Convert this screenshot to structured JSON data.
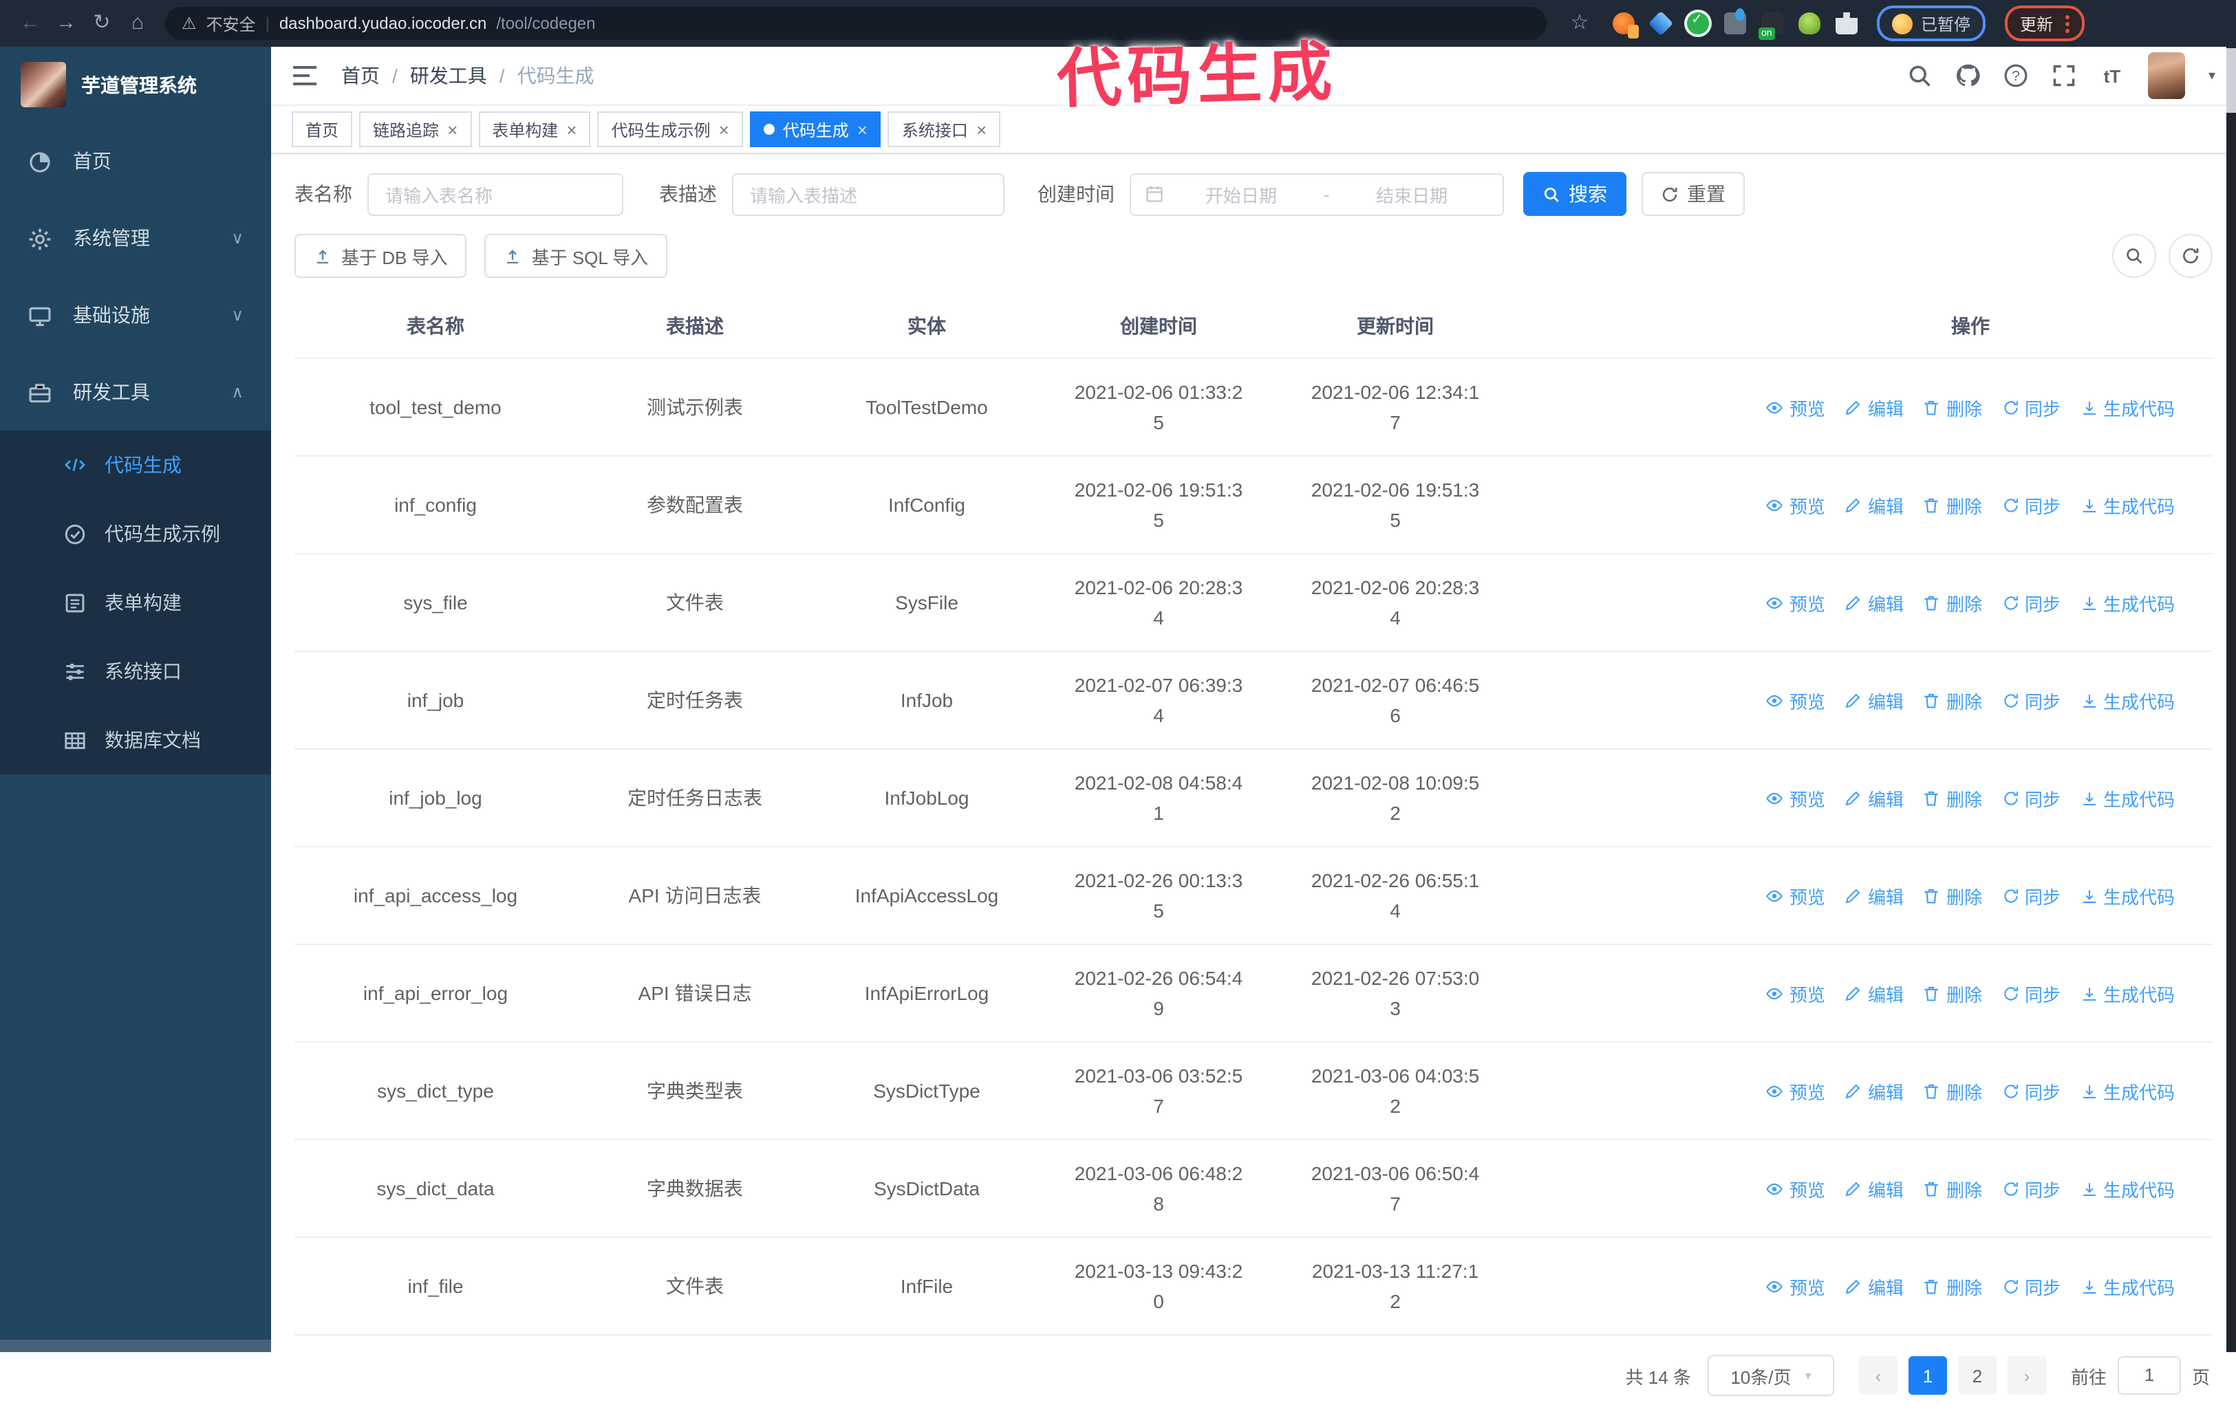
{
  "annotation": {
    "text": "代码生成"
  },
  "browser": {
    "security_label": "不安全",
    "url_host": "dashboard.yudao.iocoder.cn",
    "url_path": "/tool/codegen",
    "paused_badge": "已暂停",
    "update_button": "更新"
  },
  "sidebar": {
    "app_title": "芋道管理系统",
    "items": [
      {
        "label": "首页",
        "icon": "home",
        "chevron": ""
      },
      {
        "label": "系统管理",
        "icon": "gear",
        "chevron": "down"
      },
      {
        "label": "基础设施",
        "icon": "infra",
        "chevron": "down"
      },
      {
        "label": "研发工具",
        "icon": "tools",
        "chevron": "up"
      }
    ],
    "subitems": [
      {
        "label": "代码生成",
        "icon": "code",
        "active": true
      },
      {
        "label": "代码生成示例",
        "icon": "example",
        "active": false
      },
      {
        "label": "表单构建",
        "icon": "form",
        "active": false
      },
      {
        "label": "系统接口",
        "icon": "api",
        "active": false
      },
      {
        "label": "数据库文档",
        "icon": "db",
        "active": false
      }
    ]
  },
  "navbar": {
    "breadcrumb": [
      "首页",
      "研发工具",
      "代码生成"
    ]
  },
  "tabs": [
    {
      "label": "首页",
      "closable": false,
      "active": false
    },
    {
      "label": "链路追踪",
      "closable": true,
      "active": false
    },
    {
      "label": "表单构建",
      "closable": true,
      "active": false
    },
    {
      "label": "代码生成示例",
      "closable": true,
      "active": false
    },
    {
      "label": "代码生成",
      "closable": true,
      "active": true
    },
    {
      "label": "系统接口",
      "closable": true,
      "active": false
    }
  ],
  "search": {
    "name_label": "表名称",
    "name_placeholder": "请输入表名称",
    "desc_label": "表描述",
    "desc_placeholder": "请输入表描述",
    "time_label": "创建时间",
    "start_placeholder": "开始日期",
    "range_separator": "-",
    "end_placeholder": "结束日期",
    "search_button": "搜索",
    "reset_button": "重置"
  },
  "toolbar": {
    "import_db": "基于 DB 导入",
    "import_sql": "基于 SQL 导入"
  },
  "table": {
    "columns": [
      "表名称",
      "表描述",
      "实体",
      "创建时间",
      "更新时间",
      "操作"
    ],
    "actions": [
      "预览",
      "编辑",
      "删除",
      "同步",
      "生成代码"
    ],
    "rows": [
      {
        "name": "tool_test_demo",
        "desc": "测试示例表",
        "entity": "ToolTestDemo",
        "created": "2021-02-06 01:33:25",
        "updated": "2021-02-06 12:34:17"
      },
      {
        "name": "inf_config",
        "desc": "参数配置表",
        "entity": "InfConfig",
        "created": "2021-02-06 19:51:35",
        "updated": "2021-02-06 19:51:35"
      },
      {
        "name": "sys_file",
        "desc": "文件表",
        "entity": "SysFile",
        "created": "2021-02-06 20:28:34",
        "updated": "2021-02-06 20:28:34"
      },
      {
        "name": "inf_job",
        "desc": "定时任务表",
        "entity": "InfJob",
        "created": "2021-02-07 06:39:34",
        "updated": "2021-02-07 06:46:56"
      },
      {
        "name": "inf_job_log",
        "desc": "定时任务日志表",
        "entity": "InfJobLog",
        "created": "2021-02-08 04:58:41",
        "updated": "2021-02-08 10:09:52"
      },
      {
        "name": "inf_api_access_log",
        "desc": "API 访问日志表",
        "entity": "InfApiAccessLog",
        "created": "2021-02-26 00:13:35",
        "updated": "2021-02-26 06:55:14"
      },
      {
        "name": "inf_api_error_log",
        "desc": "API 错误日志",
        "entity": "InfApiErrorLog",
        "created": "2021-02-26 06:54:49",
        "updated": "2021-02-26 07:53:03"
      },
      {
        "name": "sys_dict_type",
        "desc": "字典类型表",
        "entity": "SysDictType",
        "created": "2021-03-06 03:52:57",
        "updated": "2021-03-06 04:03:52"
      },
      {
        "name": "sys_dict_data",
        "desc": "字典数据表",
        "entity": "SysDictData",
        "created": "2021-03-06 06:48:28",
        "updated": "2021-03-06 06:50:47"
      },
      {
        "name": "inf_file",
        "desc": "文件表",
        "entity": "InfFile",
        "created": "2021-03-13 09:43:20",
        "updated": "2021-03-13 11:27:12"
      }
    ]
  },
  "pagination": {
    "total": "共 14 条",
    "page_size": "10条/页",
    "pages": [
      "1",
      "2"
    ],
    "active_page": "1",
    "goto_label": "前往",
    "goto_value": "1",
    "page_suffix": "页"
  },
  "colors": {
    "accent": "#1b80f5",
    "link": "#409eff",
    "sidebar_bg": "#22455f",
    "submenu_bg": "#1b3044",
    "annotation": "#f53c5d"
  }
}
